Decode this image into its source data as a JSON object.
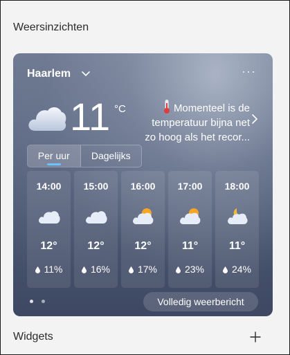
{
  "panel": {
    "section_title": "Weersinzichten",
    "widgets_title": "Widgets"
  },
  "weather": {
    "location": "Haarlem",
    "current_temp": "11",
    "unit": "°C",
    "condition_icon": "cloudy-icon",
    "alert_icon": "thermometer-icon",
    "alert_text": "Momenteel is de temperatuur bijna net zo hoog als het recor...",
    "tabs": [
      {
        "label": "Per uur",
        "selected": true
      },
      {
        "label": "Dagelijks",
        "selected": false
      }
    ],
    "hourly": [
      {
        "time": "14:00",
        "icon": "cloud-icon",
        "temp": "12°",
        "precip": "11%"
      },
      {
        "time": "15:00",
        "icon": "cloud-icon",
        "temp": "12°",
        "precip": "16%"
      },
      {
        "time": "16:00",
        "icon": "partly-sunny-icon",
        "temp": "12°",
        "precip": "17%"
      },
      {
        "time": "17:00",
        "icon": "partly-sunny-icon",
        "temp": "11°",
        "precip": "23%"
      },
      {
        "time": "18:00",
        "icon": "partly-cloudy-night-icon",
        "temp": "11°",
        "precip": "24%"
      }
    ],
    "full_forecast_label": "Volledig weerbericht",
    "page_dots": {
      "count": 2,
      "active": 0
    }
  },
  "colors": {
    "accent": "#6cc3ff",
    "sun": "#f6a623",
    "moon": "#f5b93a"
  }
}
